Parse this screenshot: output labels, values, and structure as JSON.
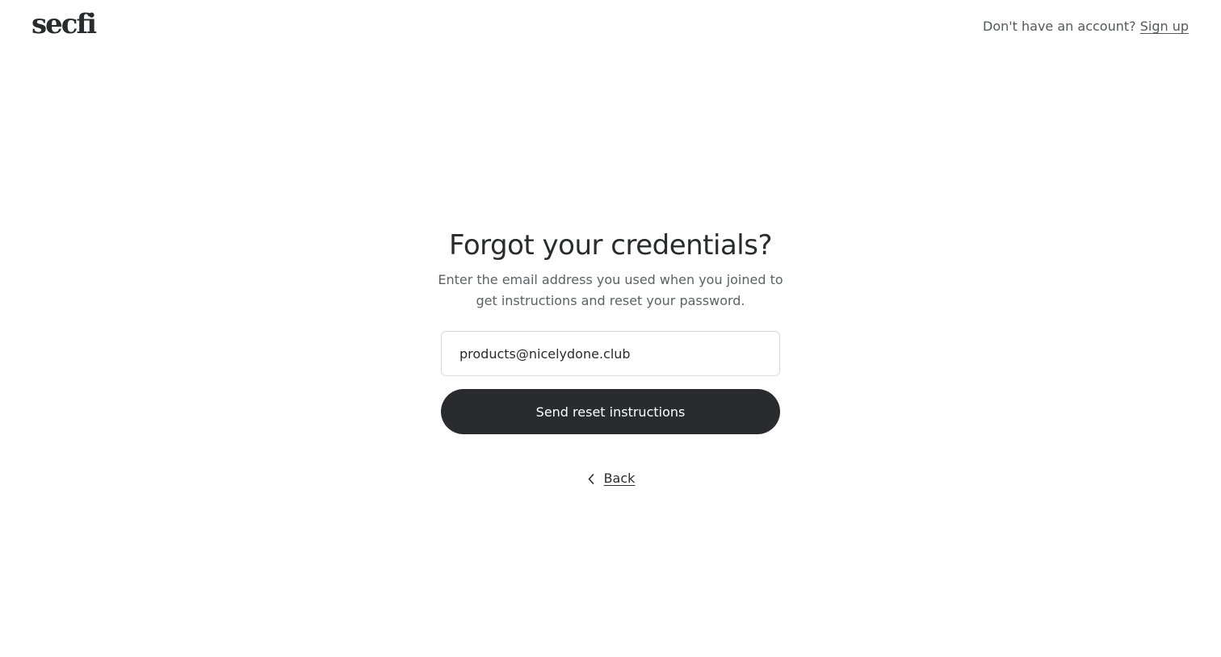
{
  "header": {
    "logo_text": "secfi",
    "signup_prompt": "Don't have an account?",
    "signup_link": "Sign up"
  },
  "form": {
    "title": "Forgot your credentials?",
    "subtitle": "Enter the email address you used when you joined to get instructions and reset your password.",
    "email_value": "products@nicelydone.club",
    "submit_label": "Send reset instructions",
    "back_label": "Back",
    "back_icon": "chevron-left-icon"
  },
  "colors": {
    "primary": "#2a2b2e",
    "muted_text": "#55575c",
    "input_border": "#d6d7da",
    "background": "#ffffff"
  }
}
